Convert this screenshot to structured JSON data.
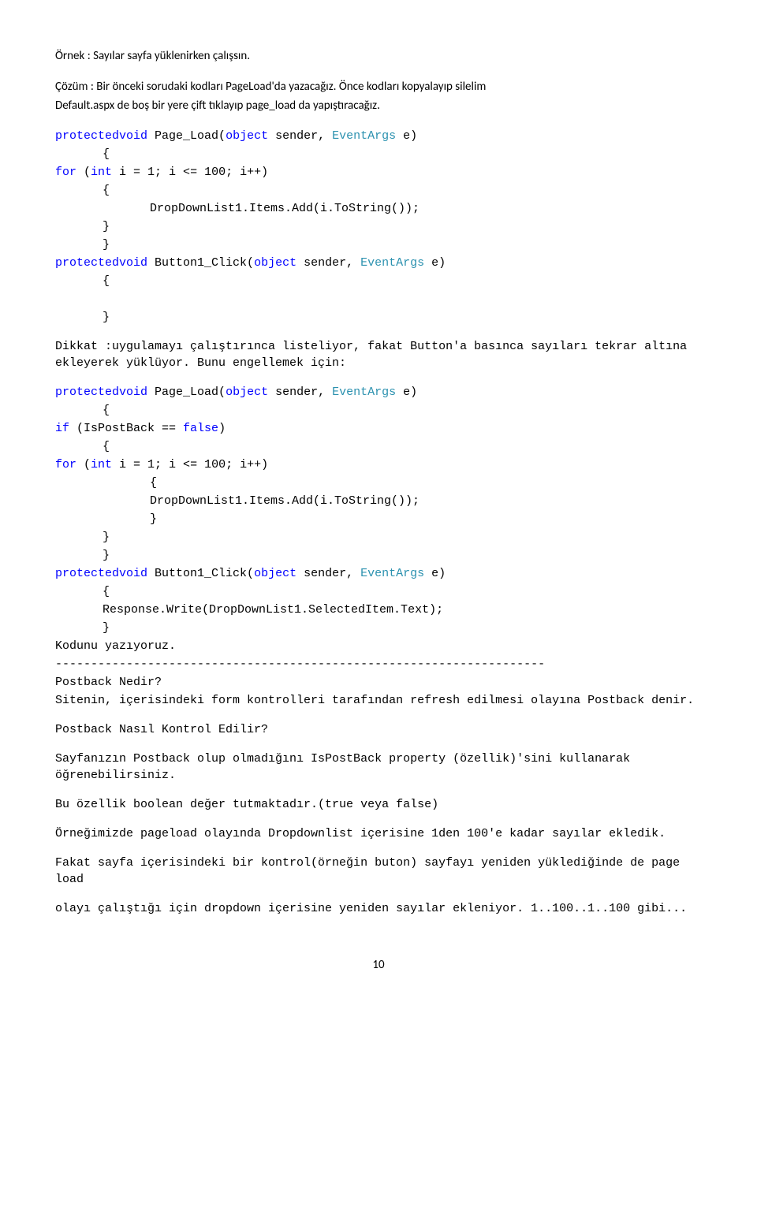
{
  "heading1": "Örnek : Sayılar sayfa yüklenirken çalışsın.",
  "heading2a": "Çözüm : Bir önceki sorudaki kodları PageLoad'da yazacağız. Önce kodları kopyalayıp silelim",
  "heading2b": "Default.aspx de boş bir yere çift tıklayıp page_load da yapıştıracağız.",
  "code1": {
    "l1a": "protectedvoid",
    "l1b": " Page_Load(",
    "l1c": "object",
    "l1d": " sender, ",
    "l1e": "EventArgs",
    "l1f": " e)",
    "l2": "{",
    "l3a": "for",
    "l3b": " (",
    "l3c": "int",
    "l3d": " i = 1; i <= 100; i++)",
    "l4": "{",
    "l5": "DropDownList1.Items.Add(i.ToString());",
    "l6": "}",
    "l7": "}",
    "l8a": "protectedvoid",
    "l8b": " Button1_Click(",
    "l8c": "object",
    "l8d": " sender, ",
    "l8e": "EventArgs",
    "l8f": " e)",
    "l9": "{",
    "l10": "}"
  },
  "mid1": "Dikkat :uygulamayı çalıştırınca listeliyor, fakat Button'a basınca sayıları tekrar altına ekleyerek yüklüyor. Bunu engellemek için:",
  "code2": {
    "l1a": "protectedvoid",
    "l1b": " Page_Load(",
    "l1c": "object",
    "l1d": " sender, ",
    "l1e": "EventArgs",
    "l1f": " e)",
    "l2": "{",
    "l3a": "if",
    "l3b": " (IsPostBack == ",
    "l3c": "false",
    "l3d": ")",
    "l4": "{",
    "l5a": "for",
    "l5b": " (",
    "l5c": "int",
    "l5d": " i = 1; i <= 100; i++)",
    "l6": "{",
    "l7": "DropDownList1.Items.Add(i.ToString());",
    "l8": "}",
    "l9": "}",
    "l10": "}",
    "l11a": "protectedvoid",
    "l11b": " Button1_Click(",
    "l11c": "object",
    "l11d": " sender, ",
    "l11e": "EventArgs",
    "l11f": " e)",
    "l12": "{",
    "l13": "Response.Write(DropDownList1.SelectedItem.Text);",
    "l14": "}",
    "l15": "Kodunu yazıyoruz."
  },
  "hr": "---------------------------------------------------------------------",
  "q1": "Postback Nedir?",
  "a1": "Sitenin, içerisindeki form kontrolleri tarafından refresh edilmesi olayına Postback denir.",
  "q2": "Postback Nasıl Kontrol Edilir?",
  "a2": "Sayfanızın Postback olup olmadığını IsPostBack property (özellik)'sini kullanarak öğrenebilirsiniz.",
  "a3": "Bu özellik boolean değer tutmaktadır.(true veya false)",
  "a4": "Örneğimizde pageload olayında Dropdownlist içerisine 1den 100'e kadar sayılar ekledik.",
  "a5": "Fakat sayfa içerisindeki bir kontrol(örneğin buton) sayfayı yeniden yüklediğinde de page load",
  "a6": "olayı çalıştığı için dropdown içerisine yeniden sayılar ekleniyor. 1..100..1..100 gibi...",
  "page": "10"
}
